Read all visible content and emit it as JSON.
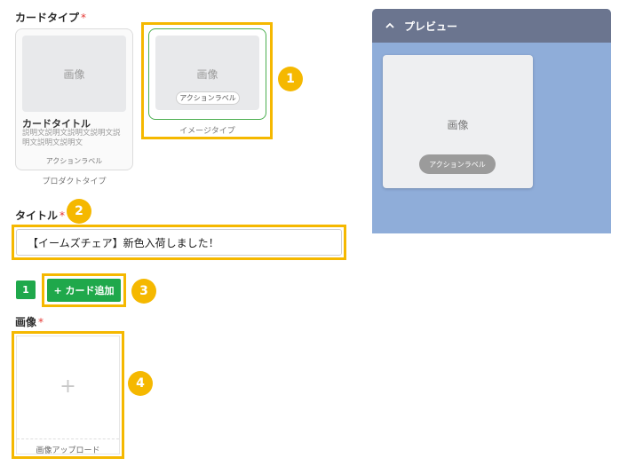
{
  "card_type": {
    "label": "カードタイプ",
    "required_mark": "*",
    "product": {
      "image_placeholder": "画像",
      "title": "カードタイトル",
      "description": "説明文説明文説明文説明文説明文説明文説明文",
      "action_label": "アクションラベル",
      "caption": "プロダクトタイプ"
    },
    "image": {
      "image_placeholder": "画像",
      "action_label": "アクションラベル",
      "caption": "イメージタイプ"
    }
  },
  "title_field": {
    "label": "タイトル",
    "required_mark": "*",
    "value": "【イームズチェア】新色入荷しました！"
  },
  "cards": {
    "index_label": "1",
    "add_button_label": "+ カード追加"
  },
  "image_field": {
    "label": "画像",
    "required_mark": "*",
    "plus": "+",
    "upload_label": "画像アップロード"
  },
  "preview": {
    "header_label": "プレビュー",
    "image_placeholder": "画像",
    "action_label": "アクションラベル"
  },
  "annotations": {
    "one": "1",
    "two": "2",
    "three": "3",
    "four": "4"
  },
  "colors": {
    "highlight": "#f5b800",
    "accent_green": "#1fa84b",
    "preview_bg": "#8fadd9",
    "preview_header": "#6b758f"
  }
}
